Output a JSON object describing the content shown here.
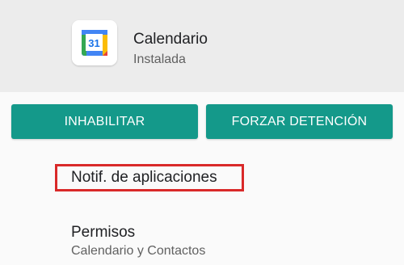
{
  "app": {
    "title": "Calendario",
    "status": "Instalada",
    "icon": "google-calendar-icon",
    "icon_day": "31"
  },
  "actions": {
    "disable_label": "INHABILITAR",
    "force_stop_label": "FORZAR DETENCIÓN"
  },
  "settings": {
    "notifications_label": "Notif. de aplicaciones",
    "permissions_label": "Permisos",
    "permissions_summary": "Calendario y Contactos"
  },
  "colors": {
    "button": "#14998a",
    "highlight": "#d92929",
    "header_background": "#ececec",
    "page_background": "#fafafa"
  }
}
